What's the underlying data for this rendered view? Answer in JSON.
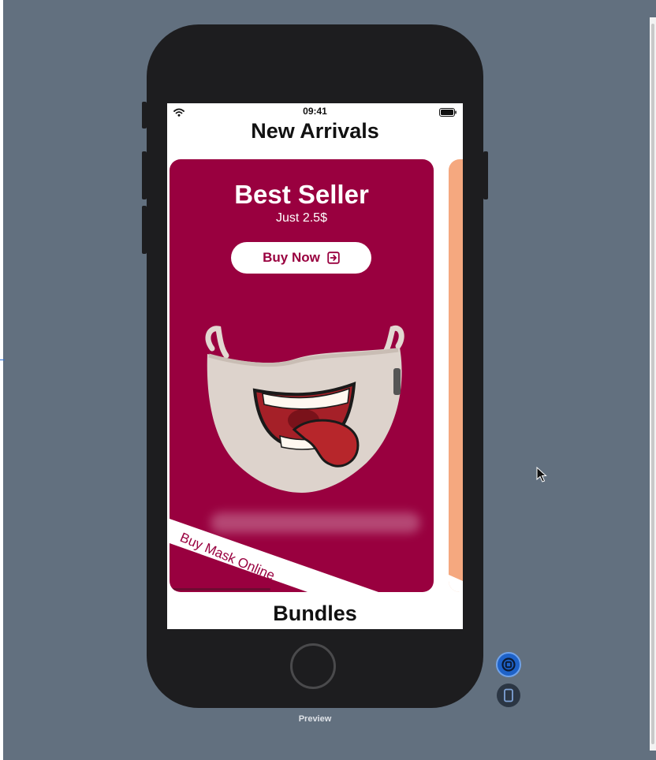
{
  "status_bar": {
    "time": "09:41"
  },
  "screen": {
    "title": "New Arrivals",
    "card": {
      "title": "Best Seller",
      "price": "Just 2.5$",
      "button_label": "Buy Now",
      "ribbon_text": "Buy Mask Online",
      "bg_color": "#99003f"
    },
    "next_card": {
      "bg_color": "#f5a87f"
    },
    "section_title": "Bundles"
  },
  "canvas": {
    "preview_label": "Preview"
  },
  "icons": {
    "wifi": "wifi-icon",
    "battery": "battery-icon",
    "buy": "arrow-right-square-icon",
    "live_preview": "live-preview-icon",
    "device_preview": "device-icon"
  }
}
